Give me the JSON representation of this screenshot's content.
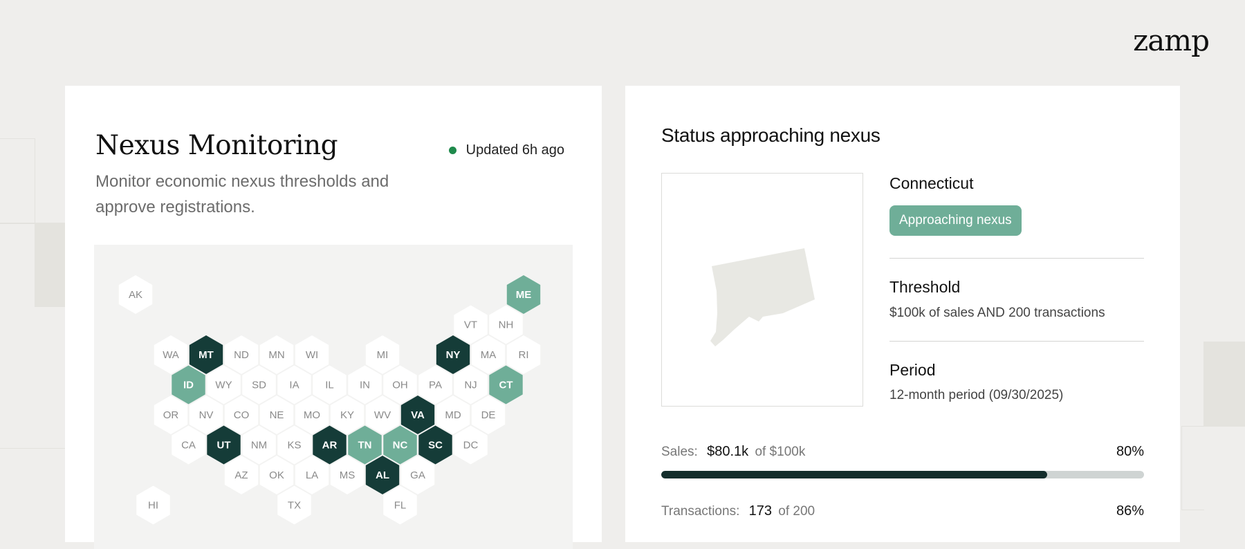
{
  "brand": {
    "logo": "zamp"
  },
  "nexus": {
    "title": "Nexus Monitoring",
    "updated": "Updated 6h ago",
    "subtitle": "Monitor economic nexus thresholds and approve registrations.",
    "colors": {
      "dark": "#153c38",
      "approaching": "#6fae98",
      "neutral": "#ffffff"
    },
    "states": [
      {
        "abbr": "AK",
        "row": 0,
        "col": 0,
        "status": "neutral"
      },
      {
        "abbr": "ME",
        "row": 0,
        "col": 11,
        "status": "approaching"
      },
      {
        "abbr": "VT",
        "row": 1,
        "col": 9.5,
        "status": "neutral"
      },
      {
        "abbr": "NH",
        "row": 1,
        "col": 10.5,
        "status": "neutral"
      },
      {
        "abbr": "WA",
        "row": 2,
        "col": 1,
        "status": "neutral"
      },
      {
        "abbr": "MT",
        "row": 2,
        "col": 2,
        "status": "nexus"
      },
      {
        "abbr": "ND",
        "row": 2,
        "col": 3,
        "status": "neutral"
      },
      {
        "abbr": "MN",
        "row": 2,
        "col": 4,
        "status": "neutral"
      },
      {
        "abbr": "WI",
        "row": 2,
        "col": 5,
        "status": "neutral"
      },
      {
        "abbr": "MI",
        "row": 2,
        "col": 7,
        "status": "neutral"
      },
      {
        "abbr": "NY",
        "row": 2,
        "col": 9,
        "status": "nexus"
      },
      {
        "abbr": "MA",
        "row": 2,
        "col": 10,
        "status": "neutral"
      },
      {
        "abbr": "RI",
        "row": 2,
        "col": 11,
        "status": "neutral"
      },
      {
        "abbr": "ID",
        "row": 3,
        "col": 1.5,
        "status": "approaching"
      },
      {
        "abbr": "WY",
        "row": 3,
        "col": 2.5,
        "status": "neutral"
      },
      {
        "abbr": "SD",
        "row": 3,
        "col": 3.5,
        "status": "neutral"
      },
      {
        "abbr": "IA",
        "row": 3,
        "col": 4.5,
        "status": "neutral"
      },
      {
        "abbr": "IL",
        "row": 3,
        "col": 5.5,
        "status": "neutral"
      },
      {
        "abbr": "IN",
        "row": 3,
        "col": 6.5,
        "status": "neutral"
      },
      {
        "abbr": "OH",
        "row": 3,
        "col": 7.5,
        "status": "neutral"
      },
      {
        "abbr": "PA",
        "row": 3,
        "col": 8.5,
        "status": "neutral"
      },
      {
        "abbr": "NJ",
        "row": 3,
        "col": 9.5,
        "status": "neutral"
      },
      {
        "abbr": "CT",
        "row": 3,
        "col": 10.5,
        "status": "approaching"
      },
      {
        "abbr": "OR",
        "row": 4,
        "col": 1,
        "status": "neutral"
      },
      {
        "abbr": "NV",
        "row": 4,
        "col": 2,
        "status": "neutral"
      },
      {
        "abbr": "CO",
        "row": 4,
        "col": 3,
        "status": "neutral"
      },
      {
        "abbr": "NE",
        "row": 4,
        "col": 4,
        "status": "neutral"
      },
      {
        "abbr": "MO",
        "row": 4,
        "col": 5,
        "status": "neutral"
      },
      {
        "abbr": "KY",
        "row": 4,
        "col": 6,
        "status": "neutral"
      },
      {
        "abbr": "WV",
        "row": 4,
        "col": 7,
        "status": "neutral"
      },
      {
        "abbr": "VA",
        "row": 4,
        "col": 8,
        "status": "nexus"
      },
      {
        "abbr": "MD",
        "row": 4,
        "col": 9,
        "status": "neutral"
      },
      {
        "abbr": "DE",
        "row": 4,
        "col": 10,
        "status": "neutral"
      },
      {
        "abbr": "CA",
        "row": 5,
        "col": 1.5,
        "status": "neutral"
      },
      {
        "abbr": "UT",
        "row": 5,
        "col": 2.5,
        "status": "nexus"
      },
      {
        "abbr": "NM",
        "row": 5,
        "col": 3.5,
        "status": "neutral"
      },
      {
        "abbr": "KS",
        "row": 5,
        "col": 4.5,
        "status": "neutral"
      },
      {
        "abbr": "AR",
        "row": 5,
        "col": 5.5,
        "status": "nexus"
      },
      {
        "abbr": "TN",
        "row": 5,
        "col": 6.5,
        "status": "approaching"
      },
      {
        "abbr": "NC",
        "row": 5,
        "col": 7.5,
        "status": "approaching"
      },
      {
        "abbr": "SC",
        "row": 5,
        "col": 8.5,
        "status": "nexus"
      },
      {
        "abbr": "DC",
        "row": 5,
        "col": 9.5,
        "status": "neutral"
      },
      {
        "abbr": "AZ",
        "row": 6,
        "col": 3,
        "status": "neutral"
      },
      {
        "abbr": "OK",
        "row": 6,
        "col": 4,
        "status": "neutral"
      },
      {
        "abbr": "LA",
        "row": 6,
        "col": 5,
        "status": "neutral"
      },
      {
        "abbr": "MS",
        "row": 6,
        "col": 6,
        "status": "neutral"
      },
      {
        "abbr": "AL",
        "row": 6,
        "col": 7,
        "status": "nexus"
      },
      {
        "abbr": "GA",
        "row": 6,
        "col": 8,
        "status": "neutral"
      },
      {
        "abbr": "HI",
        "row": 7,
        "col": 0.5,
        "status": "neutral"
      },
      {
        "abbr": "TX",
        "row": 7,
        "col": 4.5,
        "status": "neutral"
      },
      {
        "abbr": "FL",
        "row": 7,
        "col": 7.5,
        "status": "neutral"
      }
    ]
  },
  "status": {
    "title": "Status approaching nexus",
    "state_name": "Connecticut",
    "badge": "Approaching nexus",
    "threshold_label": "Threshold",
    "threshold_value": "$100k of sales AND 200 transactions",
    "period_label": "Period",
    "period_value": "12-month period (09/30/2025)",
    "sales": {
      "label": "Sales:",
      "current": "$80.1k",
      "of_text": "of $100k",
      "percent": "80%",
      "fraction": 0.8
    },
    "transactions": {
      "label": "Transactions:",
      "current": "173",
      "of_text": "of 200",
      "percent": "86%",
      "fraction": 0.865
    }
  }
}
